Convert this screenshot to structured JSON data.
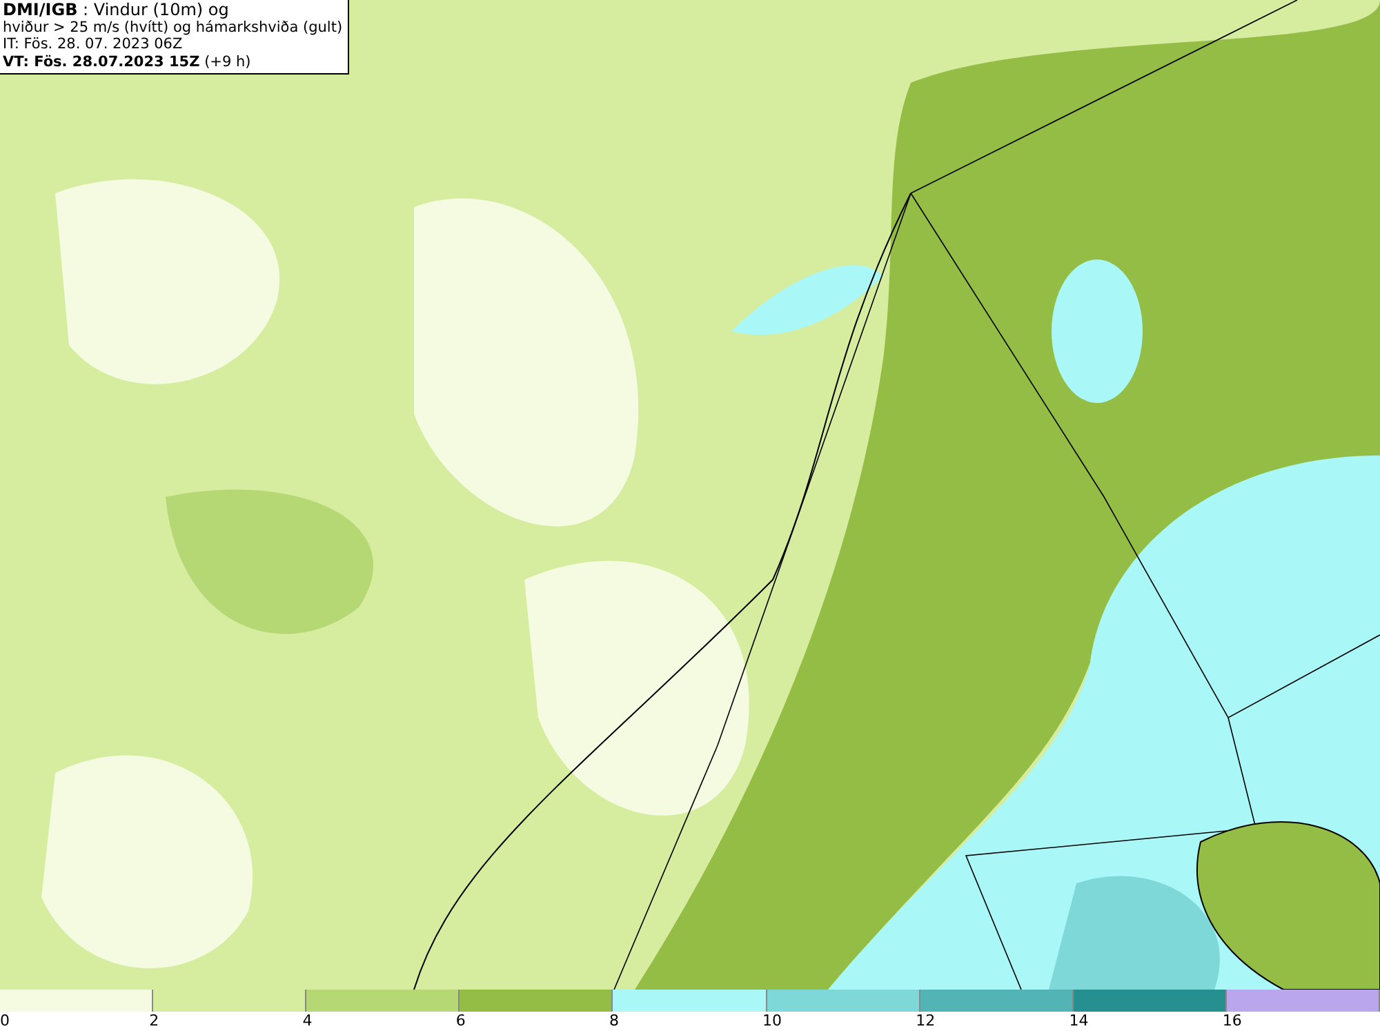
{
  "info": {
    "lines": [
      "**DMI/IGB** : Vindur (10m) og",
      "hviður > 25 m/s (hvítt) og hámarkshviða (gult)",
      "IT: Fös. 28. 07. 2023 06Z",
      "**VT: Fös. 28.07.2023 15Z** (+9 h)"
    ]
  },
  "legend": [
    {
      "label": "0",
      "color": "#f5fbe0"
    },
    {
      "label": "2",
      "color": "#d6ec9f"
    },
    {
      "label": "4",
      "color": "#b5d874"
    },
    {
      "label": "6",
      "color": "#94bd46"
    },
    {
      "label": "8",
      "color": "#aaf7f7"
    },
    {
      "label": "10",
      "color": "#7fd8d8"
    },
    {
      "label": "12",
      "color": "#52b4b4"
    },
    {
      "label": "14",
      "color": "#269090"
    },
    {
      "label": "16",
      "color": "#b9a6ec"
    }
  ]
}
